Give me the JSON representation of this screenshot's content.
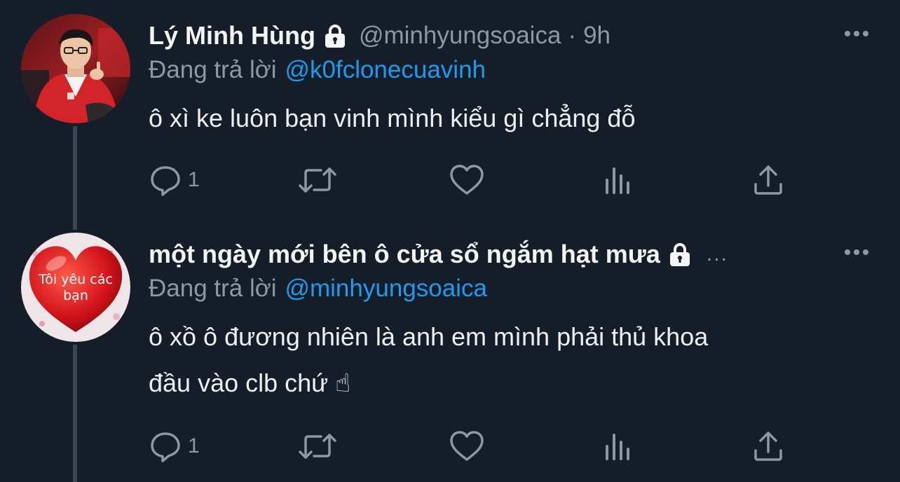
{
  "tweets": [
    {
      "display_name": "Lý Minh Hùng",
      "handle": "@minhyungsoaica",
      "separator": "·",
      "time": "9h",
      "replying_prefix": "Đang trả lời",
      "replying_to": "@k0fclonecuavinh",
      "text": "ô xì ke luôn bạn vinh mình kiểu gì chẳng đỗ",
      "reply_count": "1",
      "avatar": "person-in-red-jacket-photo",
      "protected": true
    },
    {
      "display_name": "một ngày mới bên ô cửa sổ ngắm hạt mưa",
      "truncation": "...",
      "replying_prefix": "Đang trả lời",
      "replying_to": "@minhyungsoaica",
      "text_line1": "ô xồ ô đương nhiên là anh em mình phải thủ khoa",
      "text_line2": "đầu vào clb chứ ☝",
      "reply_count": "1",
      "avatar_text": "Tôi yêu các bạn",
      "avatar": "red-heart-image",
      "protected": true
    }
  ],
  "colors": {
    "background": "#151d28",
    "link": "#1d9bf0",
    "muted": "#8b98a5",
    "thread_line": "#3d4650"
  },
  "icons": [
    "lock-icon",
    "more-icon",
    "reply-icon",
    "retweet-icon",
    "like-icon",
    "analytics-icon",
    "share-icon"
  ]
}
